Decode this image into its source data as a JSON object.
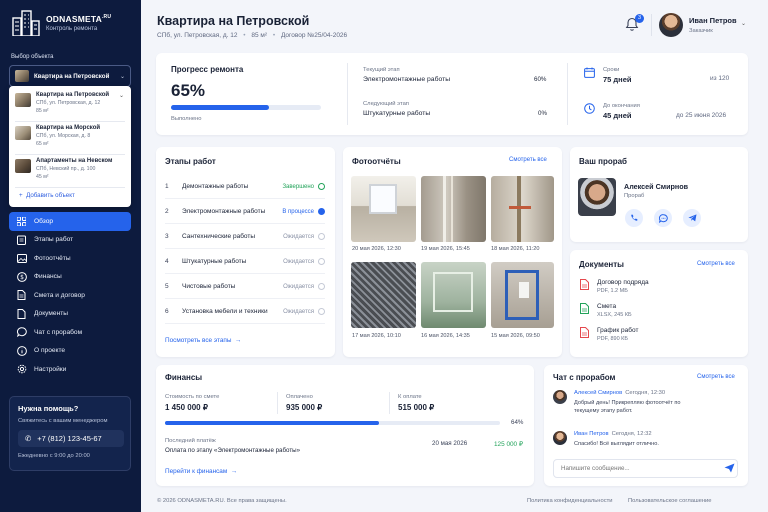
{
  "brand": {
    "name": "ODNASMETA",
    "tld": ".RU",
    "subtitle": "Контроль ремонта"
  },
  "object_selector": {
    "label": "Выбор объекта",
    "selected": "Квартира на Петровской",
    "options": [
      {
        "title": "Квартира на Петровской",
        "address": "СПб, ул. Петровская, д. 12",
        "area": "85 м²"
      },
      {
        "title": "Квартира на Морской",
        "address": "СПб, ул. Морская, д. 8",
        "area": "65 м²"
      },
      {
        "title": "Апартаменты на Невском",
        "address": "СПб, Невский пр., д. 100",
        "area": "45 м²"
      }
    ],
    "add_label": "Добавить объект"
  },
  "nav": [
    {
      "label": "Обзор",
      "icon": "grid-icon",
      "active": true
    },
    {
      "label": "Этапы работ",
      "icon": "clipboard-icon"
    },
    {
      "label": "Фотоотчёты",
      "icon": "image-icon"
    },
    {
      "label": "Финансы",
      "icon": "dollar-icon"
    },
    {
      "label": "Смета и договор",
      "icon": "document-icon"
    },
    {
      "label": "Документы",
      "icon": "file-icon"
    },
    {
      "label": "Чат с прорабом",
      "icon": "chat-icon"
    },
    {
      "label": "О проекте",
      "icon": "info-icon"
    },
    {
      "label": "Настройки",
      "icon": "gear-icon"
    }
  ],
  "help": {
    "title": "Нужна помощь?",
    "subtitle": "Свяжитесь с вашим менеджером",
    "phone": "+7 (812) 123-45-67",
    "hours": "Ежедневно с 9:00 до 20:00"
  },
  "header": {
    "title": "Квартира на Петровской",
    "address": "СПб, ул. Петровская, д. 12",
    "area": "85 м²",
    "contract": "Договор №25/04-2026",
    "notifications": "3",
    "user_name": "Иван Петров",
    "user_role": "Заказчик"
  },
  "progress": {
    "title": "Прогресс ремонта",
    "percent_text": "65%",
    "percent": 65,
    "done_label": "Выполнено",
    "current_label": "Текущий этап",
    "current_name": "Электромонтажные работы",
    "current_pct": "60%",
    "next_label": "Следующий этап",
    "next_name": "Штукатурные работы",
    "next_pct": "0%",
    "term_label": "Сроки",
    "term_value": "75 дней",
    "term_total": "из 120",
    "deadline_label": "До окончания",
    "deadline_value": "45 дней",
    "deadline_date": "до 25 июня 2026"
  },
  "stages": {
    "title": "Этапы работ",
    "items": [
      {
        "num": "1",
        "name": "Демонтажные работы",
        "status": "Завершено",
        "color": "#22a35a"
      },
      {
        "num": "2",
        "name": "Электромонтажные работы",
        "status": "В процессе",
        "color": "#2563eb"
      },
      {
        "num": "3",
        "name": "Сантехнические работы",
        "status": "Ожидается",
        "color": "#8a92a6"
      },
      {
        "num": "4",
        "name": "Штукатурные работы",
        "status": "Ожидается",
        "color": "#8a92a6"
      },
      {
        "num": "5",
        "name": "Чистовые работы",
        "status": "Ожидается",
        "color": "#8a92a6"
      },
      {
        "num": "6",
        "name": "Установка мебели и техники",
        "status": "Ожидается",
        "color": "#8a92a6"
      }
    ],
    "link": "Посмотреть все этапы"
  },
  "photos": {
    "title": "Фотоотчёты",
    "link": "Смотреть все",
    "captions": [
      "20 мая 2026, 12:30",
      "19 мая 2026, 15:45",
      "18 мая 2026, 11:20",
      "17 мая 2026, 10:10",
      "16 мая 2026, 14:35",
      "15 мая 2026, 09:50"
    ]
  },
  "foreman": {
    "title": "Ваш прораб",
    "name": "Алексей Смирнов",
    "role": "Прораб"
  },
  "documents": {
    "title": "Документы",
    "link": "Смотреть все",
    "items": [
      {
        "name": "Договор подряда",
        "meta": "PDF, 1.2 МБ",
        "color": "#e5484d"
      },
      {
        "name": "Смета",
        "meta": "XLSX, 245 КБ",
        "color": "#22a35a"
      },
      {
        "name": "График работ",
        "meta": "PDF, 890 КБ",
        "color": "#e5484d"
      }
    ]
  },
  "finance": {
    "title": "Финансы",
    "cost_label": "Стоимость по смете",
    "cost_value": "1 450 000 ₽",
    "paid_label": "Оплачено",
    "paid_value": "935 000 ₽",
    "due_label": "К оплате",
    "due_value": "515 000 ₽",
    "paid_pct_text": "64%",
    "paid_pct": 64,
    "last_label": "Последний платёж",
    "last_desc": "Оплата по этапу «Электромонтажные работы»",
    "last_date": "20 мая 2026",
    "last_amount": "125 000 ₽",
    "link": "Перейти к финансам"
  },
  "chat": {
    "title": "Чат с прорабом",
    "link": "Смотреть все",
    "messages": [
      {
        "name": "Алексей Смирнов",
        "time": "Сегодня, 12:30",
        "text": "Добрый день! Прикрепляю фотоотчёт по текущему этапу работ."
      },
      {
        "name": "Иван Петров",
        "time": "Сегодня, 12:32",
        "text": "Спасибо! Всё выглядит отлично."
      }
    ],
    "placeholder": "Напишите сообщение..."
  },
  "footer": {
    "copyright": "© 2026 ODNASMETA.RU. Все права защищены.",
    "privacy": "Политика конфиденциальности",
    "terms": "Пользовательское соглашение"
  }
}
